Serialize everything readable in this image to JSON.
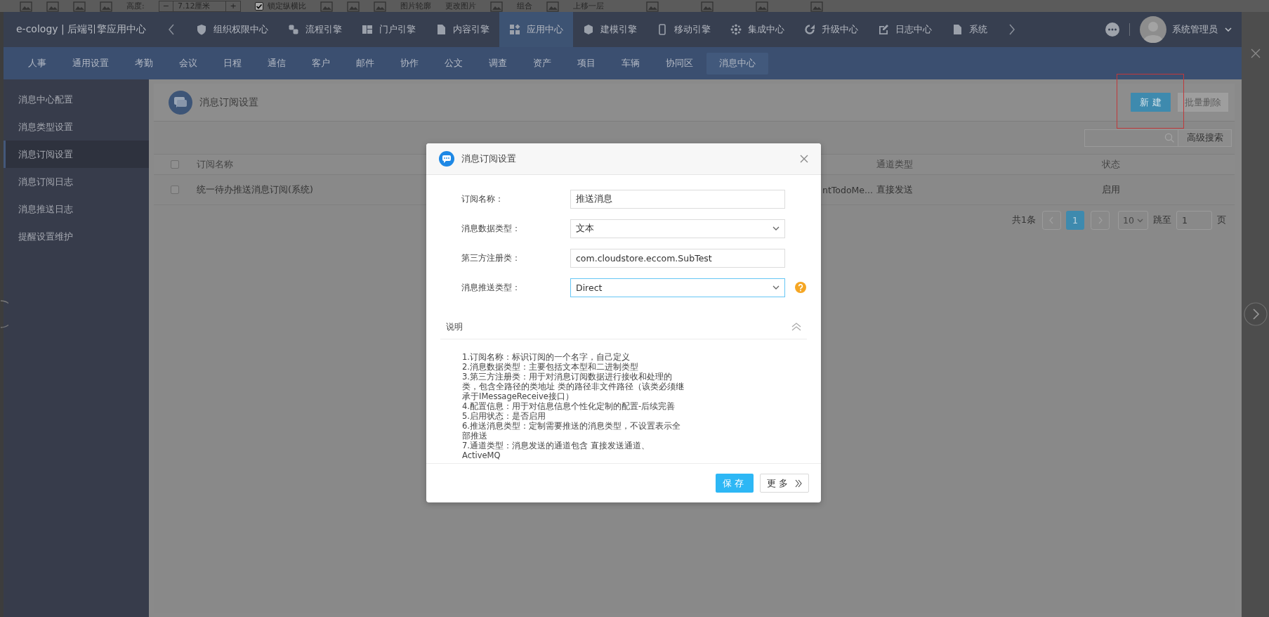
{
  "toolbar": {
    "height_label": "高度:",
    "minus": "−",
    "height_value": "7.12厘米",
    "plus": "+",
    "lock_ratio": {
      "label": "锁定纵横比",
      "checked": true
    },
    "outline_label": "图片轮廓",
    "change_label": "更改图片",
    "group_label": "组合",
    "bring_forward_label": "上移一层"
  },
  "app": {
    "brand": "e-cology | 后端引擎应用中心",
    "top_nav": [
      {
        "label": "组织权限中心",
        "selected": false
      },
      {
        "label": "流程引擎",
        "selected": false
      },
      {
        "label": "门户引擎",
        "selected": false
      },
      {
        "label": "内容引擎",
        "selected": false
      },
      {
        "label": "应用中心",
        "selected": true
      },
      {
        "label": "建模引擎",
        "selected": false
      },
      {
        "label": "移动引擎",
        "selected": false
      },
      {
        "label": "集成中心",
        "selected": false
      },
      {
        "label": "升级中心",
        "selected": false
      },
      {
        "label": "日志中心",
        "selected": false
      },
      {
        "label": "系统",
        "selected": false
      }
    ],
    "user": {
      "name": "系统管理员"
    },
    "sub_nav": [
      {
        "label": "人事",
        "selected": false
      },
      {
        "label": "通用设置",
        "selected": false
      },
      {
        "label": "考勤",
        "selected": false
      },
      {
        "label": "会议",
        "selected": false
      },
      {
        "label": "日程",
        "selected": false
      },
      {
        "label": "通信",
        "selected": false
      },
      {
        "label": "客户",
        "selected": false
      },
      {
        "label": "邮件",
        "selected": false
      },
      {
        "label": "协作",
        "selected": false
      },
      {
        "label": "公文",
        "selected": false
      },
      {
        "label": "调查",
        "selected": false
      },
      {
        "label": "资产",
        "selected": false
      },
      {
        "label": "项目",
        "selected": false
      },
      {
        "label": "车辆",
        "selected": false
      },
      {
        "label": "协同区",
        "selected": false
      },
      {
        "label": "消息中心",
        "selected": true
      }
    ],
    "sidebar": {
      "items": [
        {
          "label": "消息中心配置",
          "selected": false
        },
        {
          "label": "消息类型设置",
          "selected": false
        },
        {
          "label": "消息订阅设置",
          "selected": true
        },
        {
          "label": "消息订阅日志",
          "selected": false
        },
        {
          "label": "消息推送日志",
          "selected": false
        },
        {
          "label": "提醒设置维护",
          "selected": false
        }
      ]
    },
    "page": {
      "title": "消息订阅设置",
      "new_button": "新建",
      "batch_delete": {
        "label": "批量删除",
        "disabled": true
      },
      "advanced_search": "高级搜索"
    },
    "table": {
      "header_checked": false,
      "columns": [
        "订阅名称",
        "",
        "通道类型",
        "状态"
      ],
      "rows": [
        {
          "checked": false,
          "cells": [
            "统一待办推送消息订阅(系统)",
            "ntTodoMe...",
            "直接发送",
            "启用"
          ]
        }
      ]
    },
    "pagination": {
      "total": "共1条",
      "pages": [
        {
          "label": "1",
          "selected": true
        }
      ],
      "page_size": "10",
      "jump_label": "跳至",
      "jump_value": "1",
      "page_unit": "页"
    }
  },
  "dialog": {
    "title": "消息订阅设置",
    "fields": [
      {
        "kind": "text",
        "label": "订阅名称：",
        "value": "推送消息",
        "focused": false,
        "help": false
      },
      {
        "kind": "select",
        "label": "消息数据类型：",
        "value": "文本",
        "focused": false,
        "help": false
      },
      {
        "kind": "text",
        "label": "第三方注册类：",
        "value": "com.cloudstore.eccom.SubTest",
        "focused": false,
        "help": false
      },
      {
        "kind": "select",
        "label": "消息推送类型：",
        "value": "Direct",
        "focused": true,
        "help": true
      }
    ],
    "description": {
      "title": "说明",
      "expanded": true,
      "items": [
        "1.订阅名称：标识订阅的一个名字，自己定义",
        "2.消息数据类型：主要包括文本型和二进制类型",
        "3.第三方注册类：用于对消息订阅数据进行接收和处理的类，包含全路径的类地址 类的路径非文件路径（该类必须继承于IMessageReceive接口）",
        "4.配置信息：用于对信息信息个性化定制的配置-后续完善",
        "5.启用状态：是否启用",
        "6.推送消息类型：定制需要推送的消息类型，不设置表示全部推送",
        "7.通道类型：消息发送的通道包含 直接发送通道、ActiveMQ"
      ]
    },
    "save_button": "保存",
    "more_button": "更多"
  }
}
